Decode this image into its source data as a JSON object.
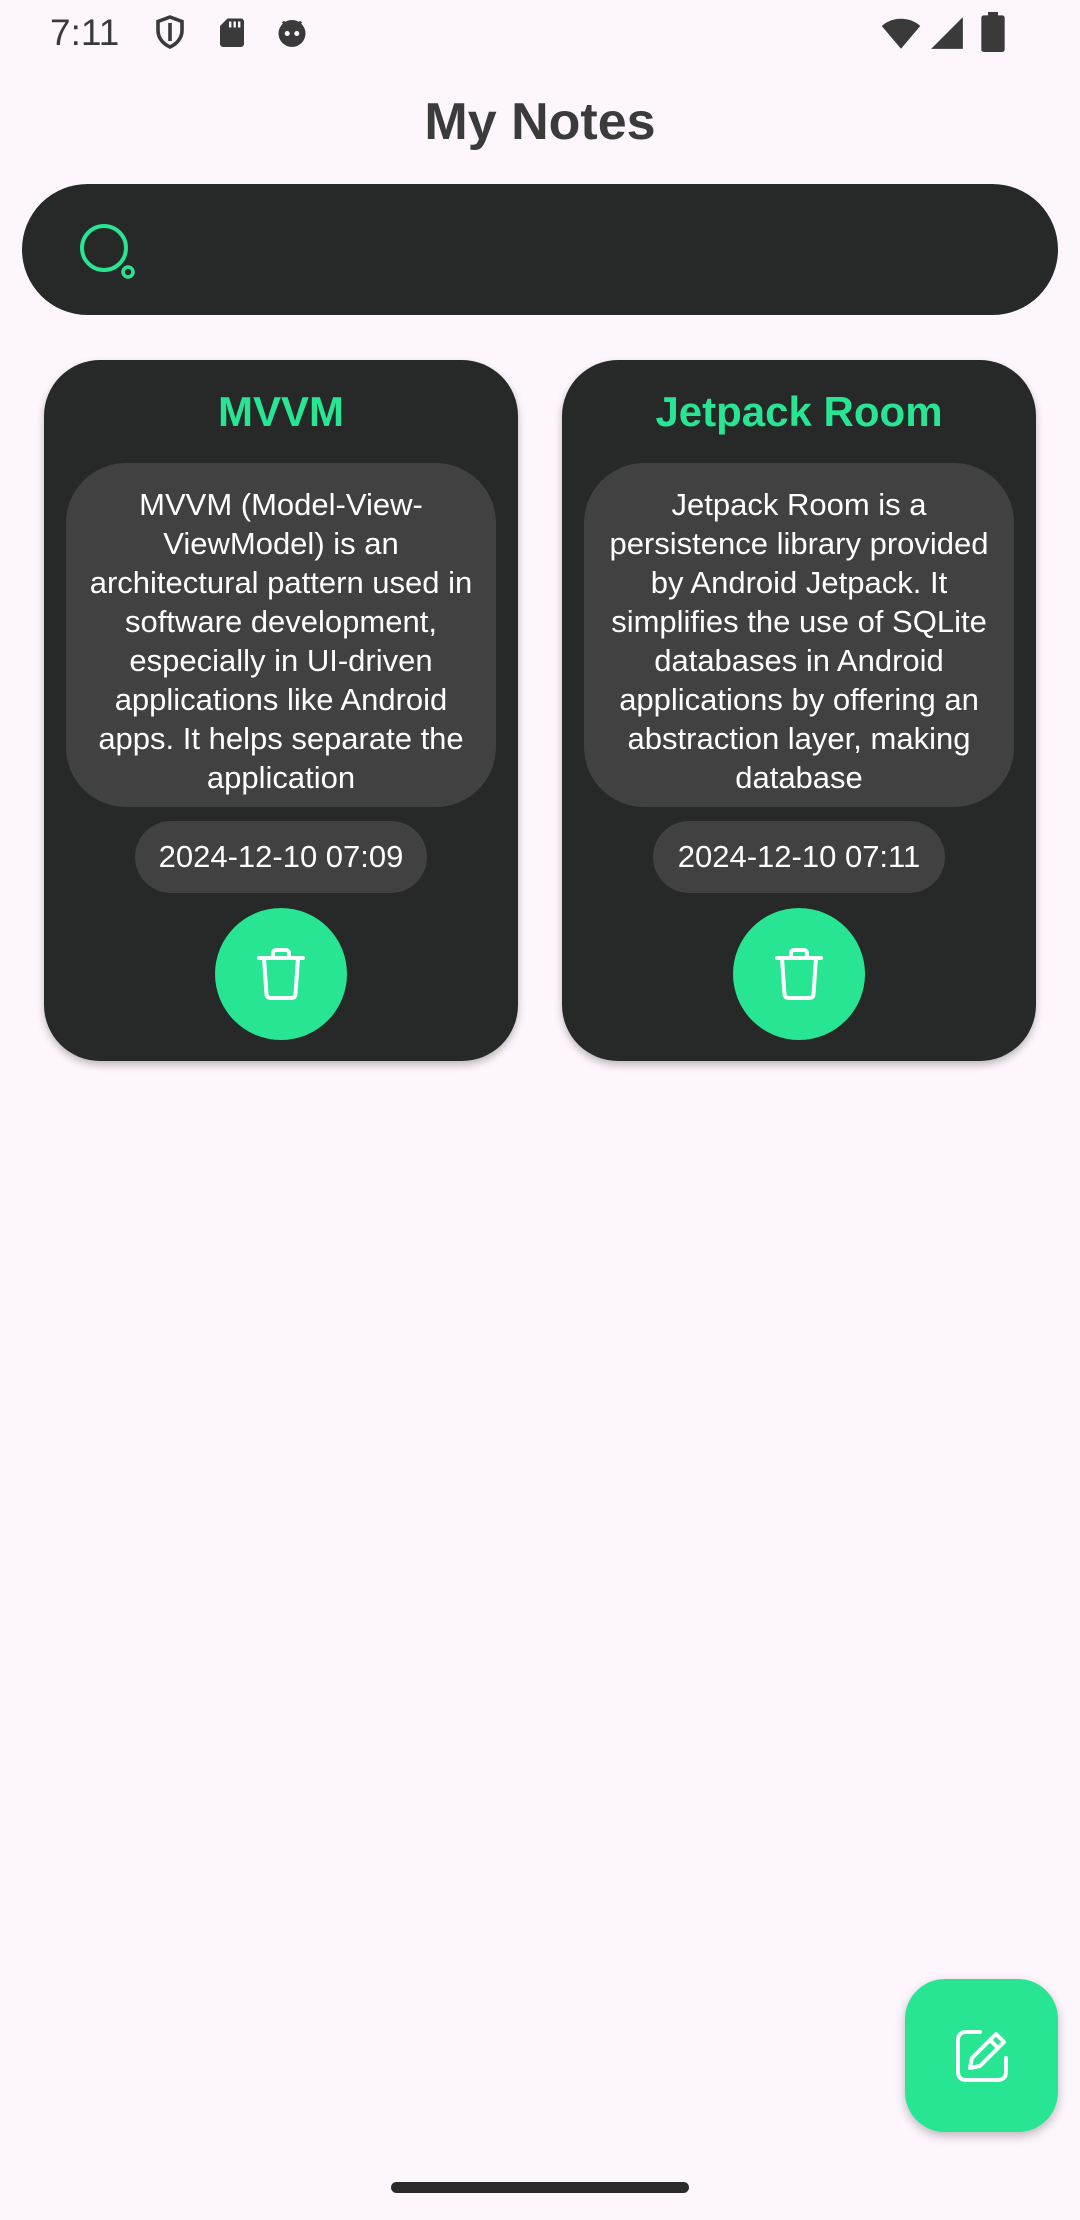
{
  "status_bar": {
    "time": "7:11",
    "icons": [
      "shield-icon",
      "sd-card-icon",
      "android-debug-icon",
      "wifi-icon",
      "signal-icon",
      "battery-icon"
    ]
  },
  "header": {
    "title": "My Notes"
  },
  "search": {
    "placeholder": "",
    "value": ""
  },
  "notes": [
    {
      "title": "MVVM",
      "body": "MVVM (Model-View-ViewModel) is an architectural pattern used in software development, especially in UI-driven applications like Android apps. It helps separate the application",
      "date": "2024-12-10 07:09",
      "delete_icon": "trash-icon"
    },
    {
      "title": "Jetpack Room",
      "body": "Jetpack Room is a persistence library provided by Android Jetpack. It simplifies the use of SQLite databases in Android applications by offering an abstraction layer, making database",
      "date": "2024-12-10 07:11",
      "delete_icon": "trash-icon"
    }
  ],
  "fab": {
    "icon": "edit-icon"
  },
  "colors": {
    "background": "#fdf6fc",
    "card": "#272928",
    "card_inner": "#404140",
    "accent": "#27e592"
  }
}
